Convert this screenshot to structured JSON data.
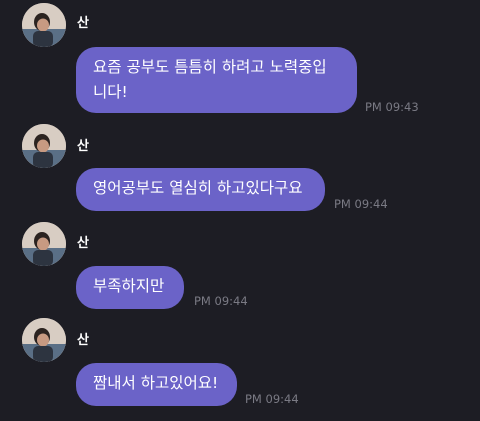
{
  "messages": [
    {
      "sender": "산",
      "text": "요즘 공부도 틈틈히 하려고 노력중입\n니다!",
      "time": "PM 09:43"
    },
    {
      "sender": "산",
      "text": "영어공부도 열심히 하고있다구요",
      "time": "PM 09:44"
    },
    {
      "sender": "산",
      "text": "부족하지만",
      "time": "PM 09:44"
    },
    {
      "sender": "산",
      "text": "짬내서 하고있어요!",
      "time": "PM 09:44"
    }
  ]
}
